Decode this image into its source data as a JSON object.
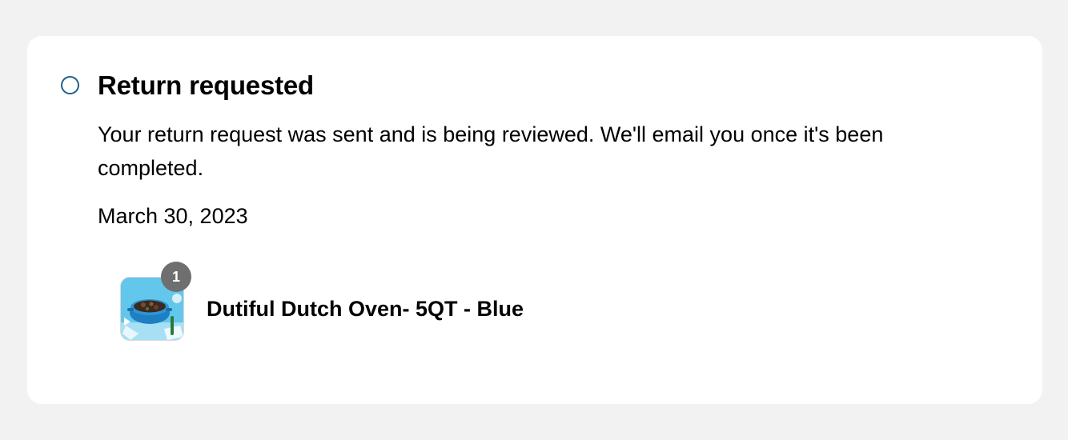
{
  "status": {
    "title": "Return requested",
    "message": "Your return request was sent and is being reviewed. We'll email you once it's been completed.",
    "date": "March 30, 2023",
    "indicator_color": "#1f5f8b"
  },
  "line_items": [
    {
      "name": "Dutiful Dutch Oven- 5QT - Blue",
      "quantity": "1",
      "image_icon": "dutch-oven-product-image"
    }
  ]
}
